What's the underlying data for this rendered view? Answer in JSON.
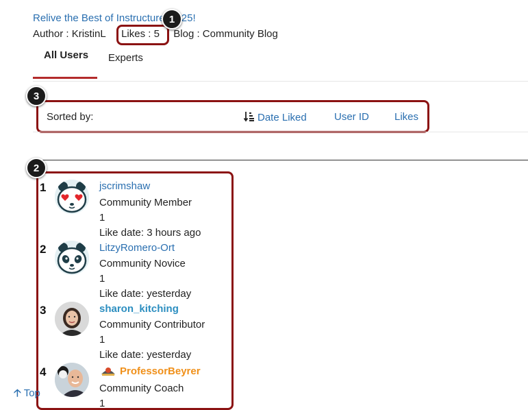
{
  "post": {
    "title": "Relive the Best of Instructurecon25!",
    "author_text": "Author : KristinL",
    "likes_text": "Likes : 5",
    "blog_text": "Blog : Community Blog"
  },
  "tabs": [
    {
      "label": "All Users",
      "active": true
    },
    {
      "label": "Experts",
      "active": false
    }
  ],
  "sort": {
    "label": "Sorted by:",
    "options": [
      "Date Liked",
      "User ID",
      "Likes"
    ],
    "active": "Date Liked"
  },
  "callouts": [
    "1",
    "2",
    "3"
  ],
  "users": [
    {
      "rank": "1",
      "name": "jscrimshaw",
      "rank_name": "Community Member",
      "count": "1",
      "like_date": "Like date: 3 hours ago",
      "avatar": "panda-hearts"
    },
    {
      "rank": "2",
      "name": "LitzyRomero-Ort",
      "rank_name": "Community Novice",
      "count": "1",
      "like_date": "Like date: yesterday",
      "avatar": "panda"
    },
    {
      "rank": "3",
      "name": "sharon_kitching",
      "rank_name": "Community Contributor",
      "count": "1",
      "like_date": "Like date: yesterday",
      "avatar": "photo-woman"
    },
    {
      "rank": "4",
      "name": "ProfessorBeyrer",
      "rank_name": "Community Coach",
      "count": "1",
      "like_date": "",
      "avatar": "photo-man"
    }
  ],
  "footer": {
    "top_label": "Top"
  },
  "colors": {
    "link": "#2a6fb0",
    "highlight": "#8b1212",
    "tab_accent": "#b32b2b",
    "coach_name": "#f0901a"
  }
}
